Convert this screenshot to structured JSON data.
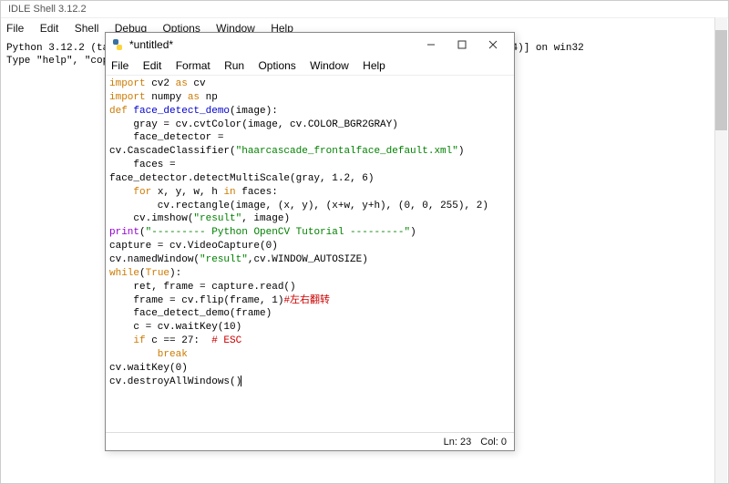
{
  "shell": {
    "title": "IDLE Shell 3.12.2",
    "menu": [
      "File",
      "Edit",
      "Shell",
      "Debug",
      "Options",
      "Window",
      "Help"
    ],
    "line1": "Python 3.12.2 (tags/v3.12.2:6abddd9, Feb  6 2024, 21:26:36) [MSC v.1937 64 bit (AMD64)] on win32",
    "line2": "Type \"help\", \"copyr"
  },
  "editor": {
    "title": "*untitled*",
    "menu": [
      "File",
      "Edit",
      "Format",
      "Run",
      "Options",
      "Window",
      "Help"
    ],
    "status_ln": "Ln: 23",
    "status_col": "Col: 0",
    "code": {
      "l1a": "import",
      "l1b": " cv2 ",
      "l1c": "as",
      "l1d": " cv",
      "l2a": "import",
      "l2b": " numpy ",
      "l2c": "as",
      "l2d": " np",
      "l3a": "def",
      "l3b": " face_detect_demo",
      "l3c": "(image):",
      "l4a": "    gray = cv.cvtColor(image, cv.COLOR_BGR2GRAY)",
      "l5a": "    face_detector =",
      "l6a": "cv.CascadeClassifier(",
      "l6b": "\"haarcascade_frontalface_default.xml\"",
      "l6c": ")",
      "l7a": "    faces =",
      "l8a": "face_detector.detectMultiScale(gray, ",
      "l8b": "1.2",
      "l8c": ", ",
      "l8d": "6",
      "l8e": ")",
      "l9a": "    for",
      "l9b": " x, y, w, h ",
      "l9c": "in",
      "l9d": " faces:",
      "l10a": "        cv.rectangle(image, (x, y), (x+w, y+h), (",
      "l10b": "0",
      "l10c": ", ",
      "l10d": "0",
      "l10e": ", ",
      "l10f": "255",
      "l10g": "), ",
      "l10h": "2",
      "l10i": ")",
      "l11a": "    cv.imshow(",
      "l11b": "\"result\"",
      "l11c": ", image)",
      "l12a": "print",
      "l12b": "(",
      "l12c": "\"--------- Python OpenCV Tutorial ---------\"",
      "l12d": ")",
      "l13a": "capture = cv.VideoCapture(",
      "l13b": "0",
      "l13c": ")",
      "l14a": "cv.namedWindow(",
      "l14b": "\"result\"",
      "l14c": ",cv.WINDOW_AUTOSIZE)",
      "l15a": "while",
      "l15b": "(",
      "l15c": "True",
      "l15d": "):",
      "l16a": "    ret, frame = capture.read()",
      "l17a": "    frame = cv.flip(frame, ",
      "l17b": "1",
      "l17c": ")",
      "l17d": "#左右翻转",
      "l18a": "    face_detect_demo(frame)",
      "l19a": "    c = cv.waitKey(",
      "l19b": "10",
      "l19c": ")",
      "l20a": "    if",
      "l20b": " c == ",
      "l20c": "27",
      "l20d": ":  ",
      "l20e": "# ESC",
      "l21a": "        break",
      "l22a": "cv.waitKey(",
      "l22b": "0",
      "l22c": ")",
      "l23a": "cv.destroyAllWindows()"
    }
  }
}
